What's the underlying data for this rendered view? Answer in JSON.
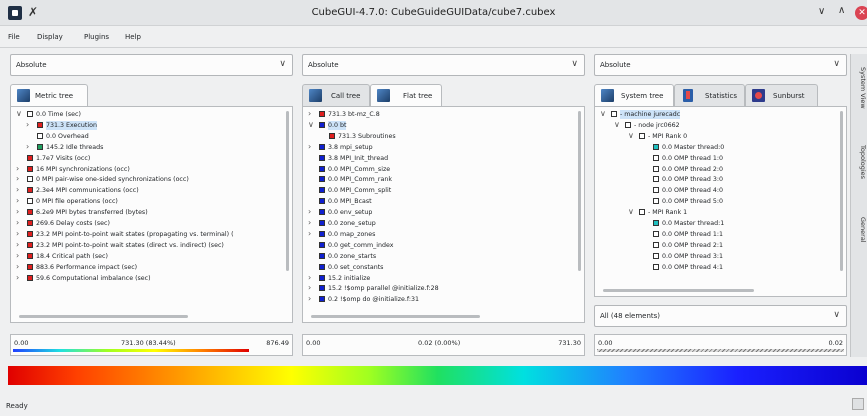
{
  "window": {
    "title": "CubeGUI-4.7.0: CubeGuideGUIData/cube7.cubex"
  },
  "menu": [
    "File",
    "Display",
    "Plugins",
    "Help"
  ],
  "panels": {
    "metric": {
      "combo": "Absolute",
      "tab": "Metric tree",
      "rows": [
        {
          "text": "0.0 Time (sec)",
          "color": "#ffffff",
          "indent": 0,
          "exp": "v"
        },
        {
          "text": "731.3 Execution",
          "color": "#e02020",
          "indent": 1,
          "exp": ">",
          "sel": true
        },
        {
          "text": "0.0 Overhead",
          "color": "#ffffff",
          "indent": 1,
          "exp": ""
        },
        {
          "text": "145.2 Idle threads",
          "color": "#20a060",
          "indent": 1,
          "exp": ">"
        },
        {
          "text": "1.7e7 Visits (occ)",
          "color": "#e02020",
          "indent": 0,
          "exp": ""
        },
        {
          "text": "16 MPI synchronizations (occ)",
          "color": "#e02020",
          "indent": 0,
          "exp": ">"
        },
        {
          "text": "0 MPI pair-wise one-sided synchronizations (occ)",
          "color": "#ffffff",
          "indent": 0,
          "exp": ">"
        },
        {
          "text": "2.3e4 MPI communications (occ)",
          "color": "#e02020",
          "indent": 0,
          "exp": ">"
        },
        {
          "text": "0 MPI file operations (occ)",
          "color": "#ffffff",
          "indent": 0,
          "exp": ">"
        },
        {
          "text": "6.2e9 MPI bytes transferred (bytes)",
          "color": "#e02020",
          "indent": 0,
          "exp": ">"
        },
        {
          "text": "269.6 Delay costs (sec)",
          "color": "#e02020",
          "indent": 0,
          "exp": ">"
        },
        {
          "text": "23.2 MPI point-to-point wait states (propagating vs. terminal) (",
          "color": "#e02020",
          "indent": 0,
          "exp": ">"
        },
        {
          "text": "23.2 MPI point-to-point wait states (direct vs. indirect) (sec)",
          "color": "#e02020",
          "indent": 0,
          "exp": ">"
        },
        {
          "text": "18.4 Critical path (sec)",
          "color": "#e02020",
          "indent": 0,
          "exp": ">"
        },
        {
          "text": "883.6 Performance impact (sec)",
          "color": "#e02020",
          "indent": 0,
          "exp": ">"
        },
        {
          "text": "59.6 Computational imbalance (sec)",
          "color": "#e02020",
          "indent": 0,
          "exp": ">"
        }
      ],
      "val_left": "0.00",
      "val_mid": "731.30 (83.44%)",
      "val_right": "876.49"
    },
    "call": {
      "combo": "Absolute",
      "tab1": "Call tree",
      "tab2": "Flat tree",
      "rows": [
        {
          "text": "731.3 bt-mz_C.8",
          "color": "#e02020",
          "indent": 0,
          "exp": ">"
        },
        {
          "text": "0.0 bt",
          "color": "#1020d0",
          "indent": 0,
          "exp": "v",
          "sel": true
        },
        {
          "text": "731.3 Subroutines",
          "color": "#e02020",
          "indent": 1,
          "exp": ""
        },
        {
          "text": "3.8 mpi_setup",
          "color": "#1020d0",
          "indent": 0,
          "exp": ">"
        },
        {
          "text": "3.8 MPI_Init_thread",
          "color": "#1020d0",
          "indent": 0,
          "exp": ""
        },
        {
          "text": "0.0 MPI_Comm_size",
          "color": "#1020d0",
          "indent": 0,
          "exp": ""
        },
        {
          "text": "0.0 MPI_Comm_rank",
          "color": "#1020d0",
          "indent": 0,
          "exp": ""
        },
        {
          "text": "0.0 MPI_Comm_split",
          "color": "#1020d0",
          "indent": 0,
          "exp": ""
        },
        {
          "text": "0.0 MPI_Bcast",
          "color": "#1020d0",
          "indent": 0,
          "exp": ""
        },
        {
          "text": "0.0 env_setup",
          "color": "#1020d0",
          "indent": 0,
          "exp": ">"
        },
        {
          "text": "0.0 zone_setup",
          "color": "#1020d0",
          "indent": 0,
          "exp": ">"
        },
        {
          "text": "0.0 map_zones",
          "color": "#1020d0",
          "indent": 0,
          "exp": ">"
        },
        {
          "text": "0.0 get_comm_index",
          "color": "#1020d0",
          "indent": 0,
          "exp": ""
        },
        {
          "text": "0.0 zone_starts",
          "color": "#1020d0",
          "indent": 0,
          "exp": ""
        },
        {
          "text": "0.0 set_constants",
          "color": "#1020d0",
          "indent": 0,
          "exp": ""
        },
        {
          "text": "15.2 initialize",
          "color": "#1020d0",
          "indent": 0,
          "exp": ">"
        },
        {
          "text": "15.2 !$omp parallel @initialize.f:28",
          "color": "#1020d0",
          "indent": 0,
          "exp": ">"
        },
        {
          "text": "0.2 !$omp do @initialize.f:31",
          "color": "#1020d0",
          "indent": 0,
          "exp": ">"
        }
      ],
      "val_left": "0.00",
      "val_mid": "0.02 (0.00%)",
      "val_right": "731.30"
    },
    "system": {
      "combo": "Absolute",
      "tab1": "System tree",
      "tab2": "Statistics",
      "tab3": "Sunburst",
      "rows": [
        {
          "text": "- machine jurecadc",
          "color": "#ffffff",
          "indent": 0,
          "exp": "v",
          "sel": true
        },
        {
          "text": "- node jrc0662",
          "color": "#ffffff",
          "indent": 1,
          "exp": "v"
        },
        {
          "text": "- MPI Rank 0",
          "color": "#ffffff",
          "indent": 2,
          "exp": "v"
        },
        {
          "text": "0.0 Master thread:0",
          "color": "#20c0c0",
          "indent": 3,
          "exp": ""
        },
        {
          "text": "0.0 OMP thread 1:0",
          "color": "#ffffff",
          "indent": 3,
          "exp": ""
        },
        {
          "text": "0.0 OMP thread 2:0",
          "color": "#ffffff",
          "indent": 3,
          "exp": ""
        },
        {
          "text": "0.0 OMP thread 3:0",
          "color": "#ffffff",
          "indent": 3,
          "exp": ""
        },
        {
          "text": "0.0 OMP thread 4:0",
          "color": "#ffffff",
          "indent": 3,
          "exp": ""
        },
        {
          "text": "0.0 OMP thread 5:0",
          "color": "#ffffff",
          "indent": 3,
          "exp": ""
        },
        {
          "text": "- MPI Rank 1",
          "color": "#ffffff",
          "indent": 2,
          "exp": "v"
        },
        {
          "text": "0.0 Master thread:1",
          "color": "#20c0c0",
          "indent": 3,
          "exp": ""
        },
        {
          "text": "0.0 OMP thread 1:1",
          "color": "#ffffff",
          "indent": 3,
          "exp": ""
        },
        {
          "text": "0.0 OMP thread 2:1",
          "color": "#ffffff",
          "indent": 3,
          "exp": ""
        },
        {
          "text": "0.0 OMP thread 3:1",
          "color": "#ffffff",
          "indent": 3,
          "exp": ""
        },
        {
          "text": "0.0 OMP thread 4:1",
          "color": "#ffffff",
          "indent": 3,
          "exp": ""
        }
      ],
      "filter": "All (48 elements)",
      "val_left": "0.00",
      "val_right": "0.02"
    }
  },
  "side_tabs": [
    "System View",
    "Topologies",
    "General"
  ],
  "status": "Ready"
}
